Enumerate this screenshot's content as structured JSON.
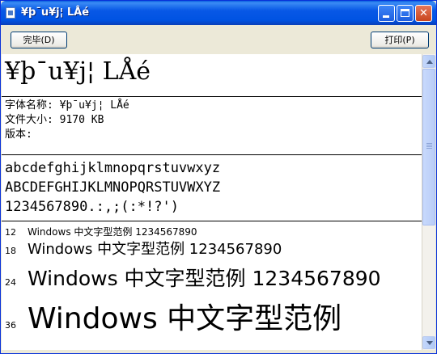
{
  "window": {
    "title": "¥þ¯u¥j¦ LÅé"
  },
  "toolbar": {
    "done_label": "完毕(D)",
    "print_label": "打印(P)"
  },
  "font": {
    "display_name": "¥þ¯u¥j¦ LÅé",
    "name_line": "字体名称: ¥þ¯u¥j¦ LÅé",
    "size_line": "文件大小: 9170 KB",
    "version_line": "版本:"
  },
  "samples": {
    "lower": "abcdefghijklmnopqrstuvwxyz",
    "upper": "ABCDEFGHIJKLMNOPQRSTUVWXYZ",
    "digits": "1234567890.:,;(:*!?')"
  },
  "size_samples": [
    {
      "size": "12",
      "text": "Windows 中文字型范例 1234567890"
    },
    {
      "size": "18",
      "text": "Windows 中文字型范例 1234567890"
    },
    {
      "size": "24",
      "text": "Windows 中文字型范例 1234567890"
    },
    {
      "size": "36",
      "text": "Windows 中文字型范例"
    }
  ]
}
